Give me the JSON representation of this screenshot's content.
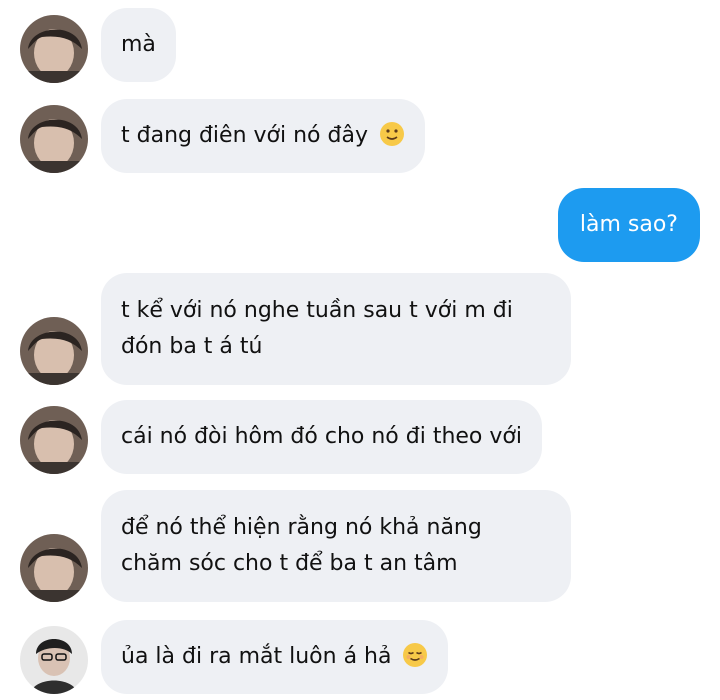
{
  "colors": {
    "incoming_bubble": "#eef0f4",
    "outgoing_bubble": "#1d9bf0",
    "text": "#111111",
    "outgoing_text": "#ffffff"
  },
  "messages": [
    {
      "side": "incoming",
      "lines": [
        "mà"
      ]
    },
    {
      "side": "incoming",
      "lines": [
        "t đang điên với nó đây"
      ],
      "emoji": "slightly-smiling-face-icon"
    },
    {
      "side": "outgoing",
      "lines": [
        "làm sao?"
      ]
    },
    {
      "side": "incoming",
      "lines": [
        "t kể với nó nghe tuần sau t với m đi",
        "đón ba t á tú"
      ]
    },
    {
      "side": "incoming",
      "lines": [
        "cái nó đòi hôm đó cho nó đi theo với"
      ]
    },
    {
      "side": "incoming",
      "lines": [
        "để nó thể hiện rằng nó khả năng",
        "chăm sóc cho t để ba t an tâm"
      ]
    },
    {
      "side": "incoming",
      "lines": [
        "ủa là đi ra mắt luôn á hả"
      ],
      "emoji": "relieved-face-icon"
    }
  ]
}
